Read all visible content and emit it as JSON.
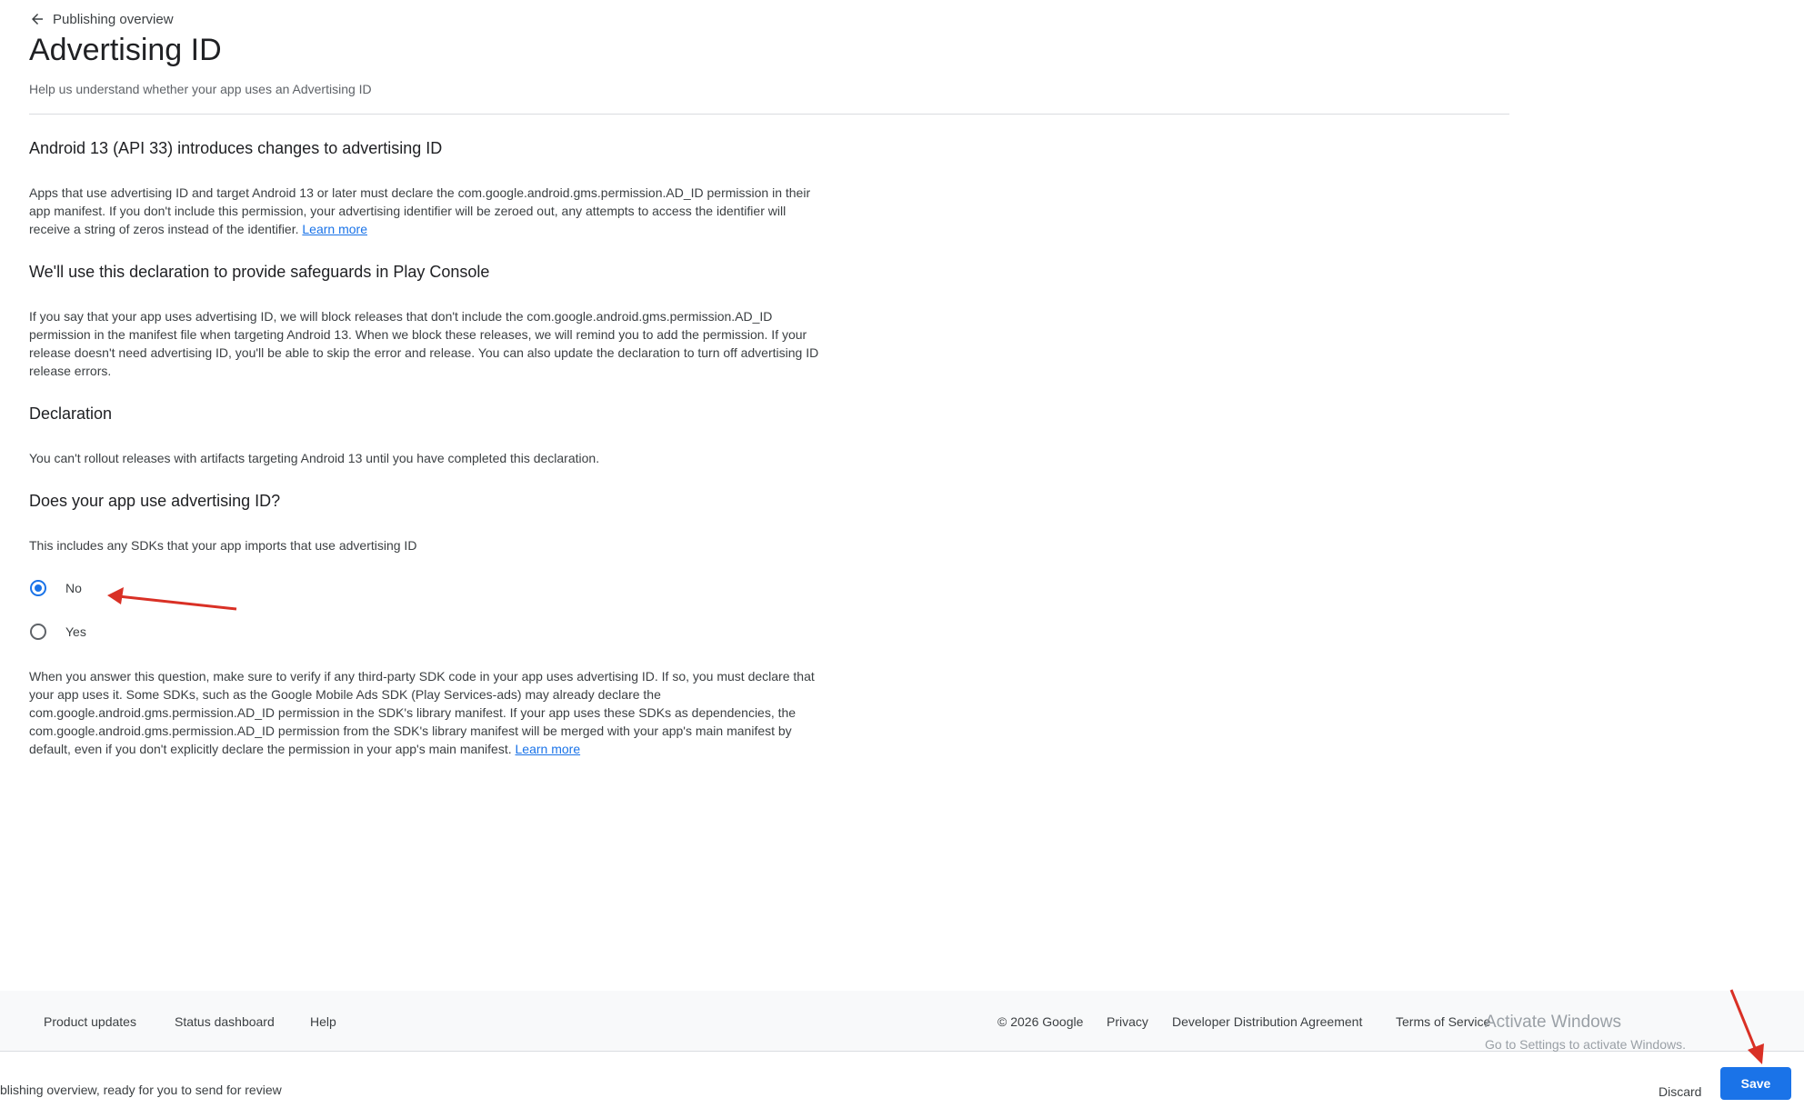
{
  "nav": {
    "back_label": "Publishing overview"
  },
  "page": {
    "title": "Advertising ID",
    "subtitle": "Help us understand whether your app uses an Advertising ID"
  },
  "sections": {
    "android13": {
      "heading": "Android 13 (API 33) introduces changes to advertising ID",
      "text": "Apps that use advertising ID and target Android 13 or later must declare the com.google.android.gms.permission.AD_ID permission in their app manifest. If you don't include this permission, your advertising identifier will be zeroed out, any attempts to access the identifier will receive a string of zeros instead of the identifier.",
      "link": "Learn more"
    },
    "safeguards": {
      "heading": "We'll use this declaration to provide safeguards in Play Console",
      "text": "If you say that your app uses advertising ID, we will block releases that don't include the com.google.android.gms.permission.AD_ID permission in the manifest file when targeting Android 13. When we block these releases, we will remind you to add the permission. If your release doesn't need advertising ID, you'll be able to skip the error and release. You can also update the declaration to turn off advertising ID release errors."
    },
    "declaration": {
      "heading": "Declaration",
      "text": "You can't rollout releases with artifacts targeting Android 13 until you have completed this declaration."
    },
    "question": {
      "heading": "Does your app use advertising ID?",
      "text": "This includes any SDKs that your app imports that use advertising ID",
      "options": [
        {
          "label": "No",
          "selected": true
        },
        {
          "label": "Yes",
          "selected": false
        }
      ],
      "note": "When you answer this question, make sure to verify if any third-party SDK code in your app uses advertising ID. If so, you must declare that your app uses it. Some SDKs, such as the Google Mobile Ads SDK (Play Services-ads) may already declare the com.google.android.gms.permission.AD_ID permission in the SDK's library manifest. If your app uses these SDKs as dependencies, the com.google.android.gms.permission.AD_ID permission from the SDK's library manifest will be merged with your app's main manifest by default, even if you don't explicitly declare the permission in your app's main manifest.",
      "note_link": "Learn more"
    }
  },
  "footer": {
    "left_links": [
      "Product updates",
      "Status dashboard",
      "Help"
    ],
    "copyright": "© 2026 Google",
    "right_links": [
      "Privacy",
      "Developer Distribution Agreement",
      "Terms of Service"
    ]
  },
  "watermark": {
    "line1": "Activate Windows",
    "line2": "Go to Settings to activate Windows."
  },
  "savebar": {
    "message": "blishing overview, ready for you to send for review",
    "discard_label": "Discard",
    "save_label": "Save"
  },
  "colors": {
    "accent": "#1a73e8",
    "annotation": "#d93025"
  },
  "icons": {
    "back": "arrow-left-icon"
  }
}
